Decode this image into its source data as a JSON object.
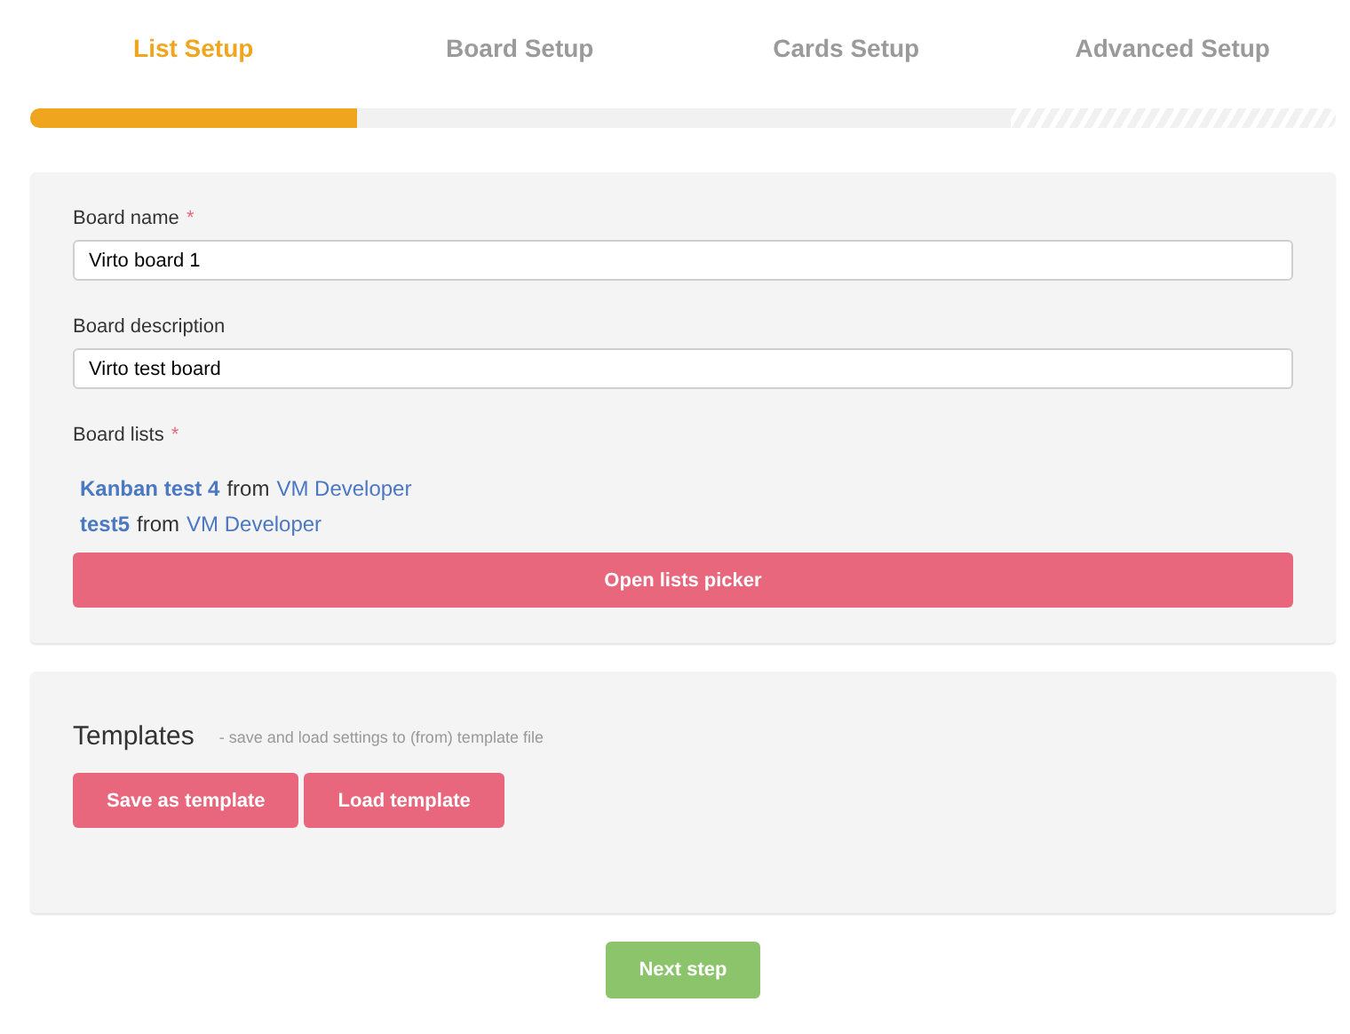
{
  "steps": [
    {
      "label": "List Setup",
      "selected": true
    },
    {
      "label": "Board Setup",
      "selected": false
    },
    {
      "label": "Cards Setup",
      "selected": false
    },
    {
      "label": "Advanced Setup",
      "selected": false
    }
  ],
  "progress": {
    "level": 0.25
  },
  "form": {
    "fields": [
      {
        "label": "Board name",
        "required": true,
        "value": "Virto board 1"
      },
      {
        "label": "Board description",
        "required": false,
        "value": "Virto test board"
      }
    ],
    "lists_label": "Board lists",
    "lists_required": true,
    "lists": [
      {
        "name": "Kanban test 4",
        "from": "from",
        "owner": "VM Developer"
      },
      {
        "name": "test5",
        "from": "from",
        "owner": "VM Developer"
      }
    ],
    "picker_button": "Open lists picker",
    "required_mark": "*"
  },
  "templates": {
    "title": "Templates",
    "hint": "- save and load settings to (from) template file",
    "buttons": [
      "Save as template",
      "Load template"
    ]
  },
  "next_button": "Next step"
}
